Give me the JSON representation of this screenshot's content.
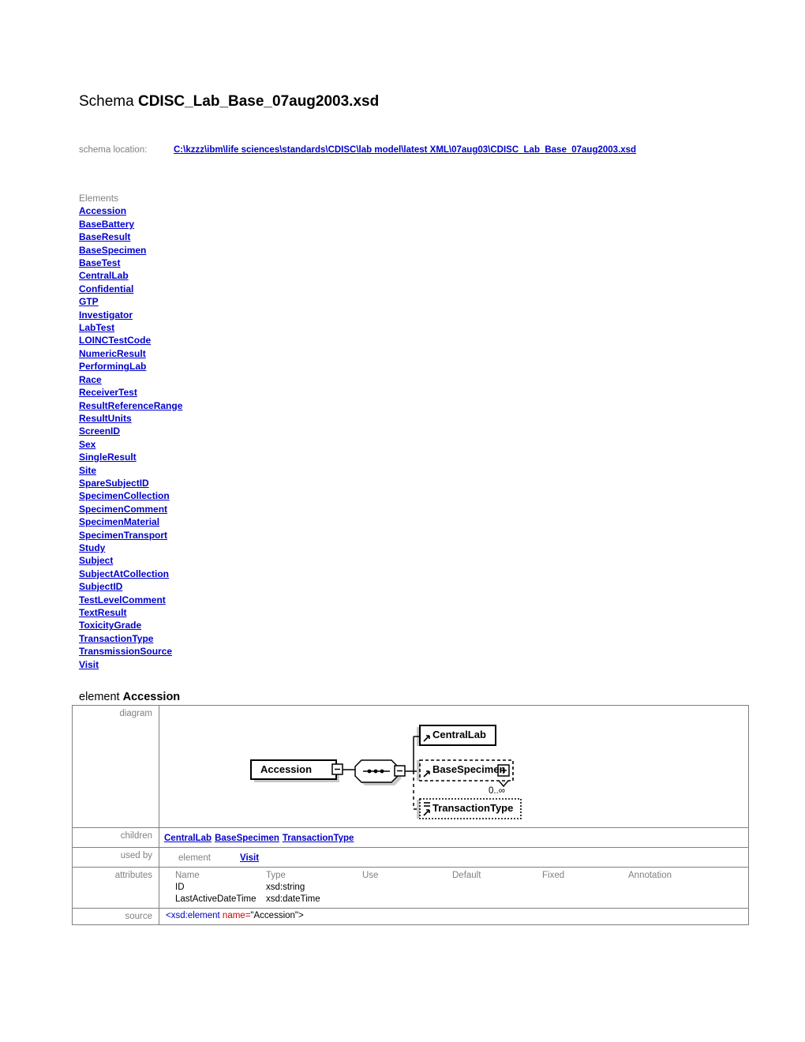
{
  "title": {
    "prefix": "Schema",
    "filename": "CDISC_Lab_Base_07aug2003.xsd"
  },
  "schema_location": {
    "label": "schema location:",
    "path": "C:\\kzzz\\ibm\\life sciences\\standards\\CDISC\\lab model\\latest XML\\07aug03\\CDISC_Lab_Base_07aug2003.xsd"
  },
  "elements_section": {
    "heading": "Elements",
    "items": [
      "Accession",
      "BaseBattery",
      "BaseResult",
      "BaseSpecimen",
      "BaseTest",
      "CentralLab",
      "Confidential",
      "GTP",
      "Investigator",
      "LabTest",
      "LOINCTestCode",
      "NumericResult",
      "PerformingLab",
      "Race",
      "ReceiverTest",
      "ResultReferenceRange",
      "ResultUnits",
      "ScreenID",
      "Sex",
      "SingleResult",
      "Site",
      "SpareSubjectID",
      "SpecimenCollection",
      "SpecimenComment",
      "SpecimenMaterial",
      "SpecimenTransport",
      "Study",
      "Subject",
      "SubjectAtCollection",
      "SubjectID",
      "TestLevelComment",
      "TextResult",
      "ToxicityGrade",
      "TransactionType",
      "TransmissionSource",
      "Visit"
    ]
  },
  "element_detail": {
    "heading_prefix": "element",
    "heading_name": "Accession",
    "rows": {
      "diagram_label": "diagram",
      "children_label": "children",
      "used_by_label": "used by",
      "attributes_label": "attributes",
      "source_label": "source"
    },
    "diagram": {
      "root": "Accession",
      "compositor": "sequence",
      "nodes": [
        {
          "name": "CentralLab",
          "style": "solid",
          "expandable": false,
          "cardinality": ""
        },
        {
          "name": "BaseSpecimen",
          "style": "dashed",
          "expandable": true,
          "cardinality": "0..∞"
        },
        {
          "name": "TransactionType",
          "style": "dotted",
          "expandable": false,
          "cardinality": ""
        }
      ]
    },
    "children": [
      "CentralLab",
      "BaseSpecimen",
      "TransactionType"
    ],
    "used_by": [
      {
        "kind": "element",
        "name": "Visit"
      }
    ],
    "attributes": {
      "columns": [
        "Name",
        "Type",
        "Use",
        "Default",
        "Fixed",
        "Annotation"
      ],
      "rows": [
        {
          "name": "ID",
          "type": "xsd:string",
          "use": "",
          "default": "",
          "fixed": "",
          "annotation": ""
        },
        {
          "name": "LastActiveDateTime",
          "type": "xsd:dateTime",
          "use": "",
          "default": "",
          "fixed": "",
          "annotation": ""
        }
      ]
    },
    "source": {
      "tag_open": "<xsd:element ",
      "attr_name": "name",
      "equals": "=",
      "attr_value": "\"Accession\">"
    }
  },
  "colors": {
    "link": "#0000CC",
    "label_gray": "#808080",
    "border": "#808080",
    "xml_tag": "#0000CC",
    "xml_attr": "#CC0000",
    "background": "#FFFFFF"
  }
}
